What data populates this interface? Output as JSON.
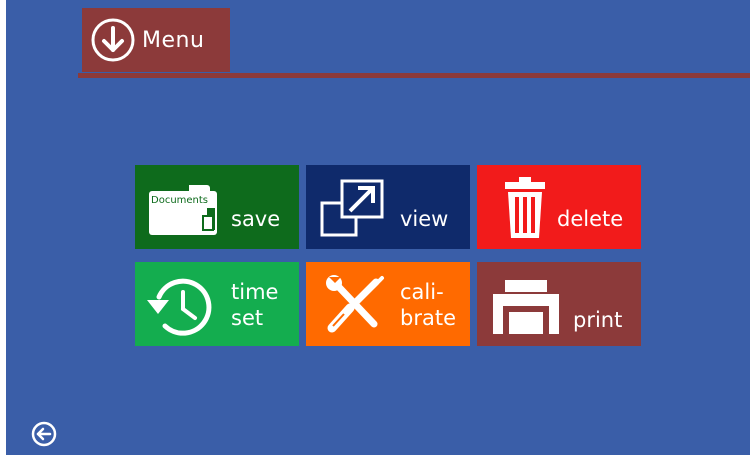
{
  "header": {
    "menu_label": "Menu",
    "accent_color": "#8c3a3a",
    "menu_icon": "circle-arrow-down-icon"
  },
  "tiles": [
    {
      "id": "save",
      "label": "save",
      "icon": "documents-folder-icon",
      "icon_text": "Documents",
      "color": "#0e6b1c"
    },
    {
      "id": "view",
      "label": "view",
      "icon": "expand-window-icon",
      "color": "#0f2a6b"
    },
    {
      "id": "delete",
      "label": "delete",
      "icon": "trash-can-icon",
      "color": "#f21b1b"
    },
    {
      "id": "time-set",
      "label_line1": "time",
      "label_line2": "set",
      "icon": "history-clock-icon",
      "color": "#14ad4f"
    },
    {
      "id": "calibrate",
      "label_line1": "cali-",
      "label_line2": "brate",
      "icon": "wrench-screwdriver-icon",
      "color": "#ff6a00"
    },
    {
      "id": "print",
      "label": "print",
      "icon": "printer-icon",
      "color": "#8c3a3a"
    }
  ],
  "footer": {
    "back_icon": "circle-arrow-left-icon"
  },
  "background_color": "#3a5ea8"
}
